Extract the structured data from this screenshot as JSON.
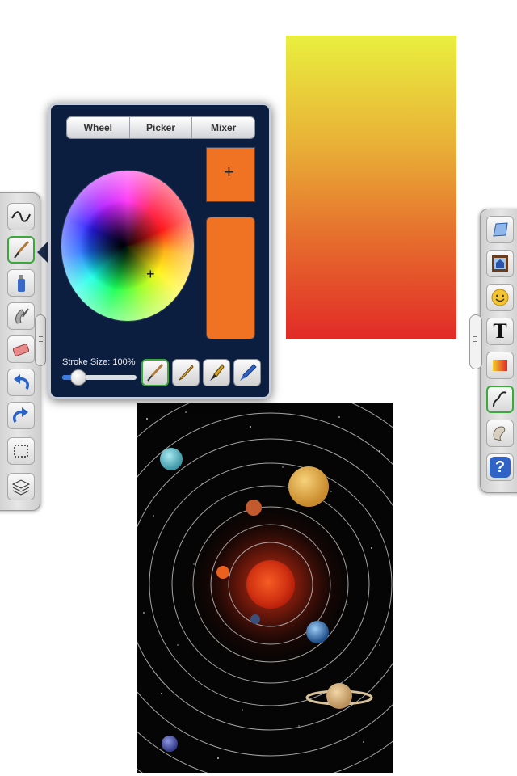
{
  "color_panel": {
    "tabs": [
      "Wheel",
      "Picker",
      "Mixer"
    ],
    "selected_color": "#ef7322",
    "stroke_label": "Stroke Size: 100%",
    "stroke_size_percent": 100
  },
  "left_toolbar": {
    "tools": [
      "freehand-curve-icon",
      "paintbrush-icon",
      "spray-can-icon",
      "smudge-icon",
      "eraser-icon",
      "undo-icon",
      "redo-icon",
      "selection-marquee-icon",
      "layers-icon"
    ],
    "active_tool": "paintbrush-icon"
  },
  "right_toolbar": {
    "tools": [
      "rectangle-shape-icon",
      "image-frame-icon",
      "smiley-icon",
      "text-icon",
      "gradient-icon",
      "curve-shape-icon",
      "stamp-icon",
      "help-icon"
    ],
    "text_glyph": "T",
    "help_glyph": "?",
    "active_tool": "curve-shape-icon"
  },
  "colors": {
    "panel_bg": "#0c1e3f",
    "accent_green": "#3aa83a",
    "gradient_top": "#e9ef3e",
    "gradient_bottom": "#e22a27"
  }
}
